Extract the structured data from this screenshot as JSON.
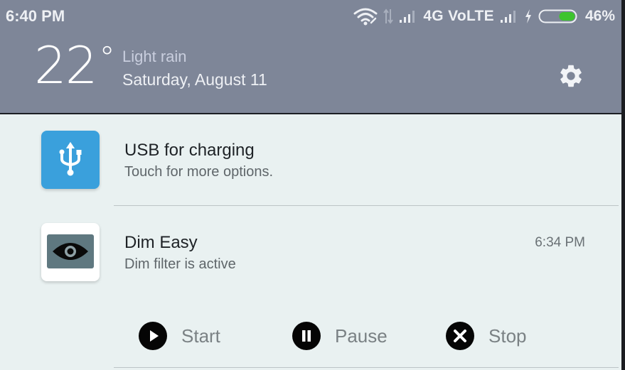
{
  "status_bar": {
    "time": "6:40 PM",
    "network_label": "4G VoLTE",
    "battery_percent": "46%",
    "battery_level": 0.46,
    "icons": [
      "wifi-icon",
      "data-transfer-icon",
      "signal-sim1-icon",
      "signal-sim2-icon",
      "charging-bolt-icon",
      "battery-icon"
    ]
  },
  "weather": {
    "temperature": "22",
    "degree_symbol": "°",
    "condition": "Light rain",
    "date": "Saturday, August 11"
  },
  "header": {
    "settings_icon": "gear-icon"
  },
  "notifications": [
    {
      "app_icon": "usb-icon",
      "title": "USB for charging",
      "text": "Touch for more options.",
      "icon_color": "#3aa0dc"
    },
    {
      "app_icon": "eye-icon",
      "title": "Dim Easy",
      "text": "Dim filter is active",
      "time": "6:34 PM",
      "actions": [
        {
          "icon": "play-icon",
          "label": "Start"
        },
        {
          "icon": "pause-icon",
          "label": "Pause"
        },
        {
          "icon": "close-icon",
          "label": "Stop"
        }
      ]
    }
  ],
  "colors": {
    "header_bg": "#7e8698",
    "panel_bg": "#e9f1f1",
    "battery_fill": "#3ec42e",
    "usb_icon_bg": "#3aa0dc"
  }
}
